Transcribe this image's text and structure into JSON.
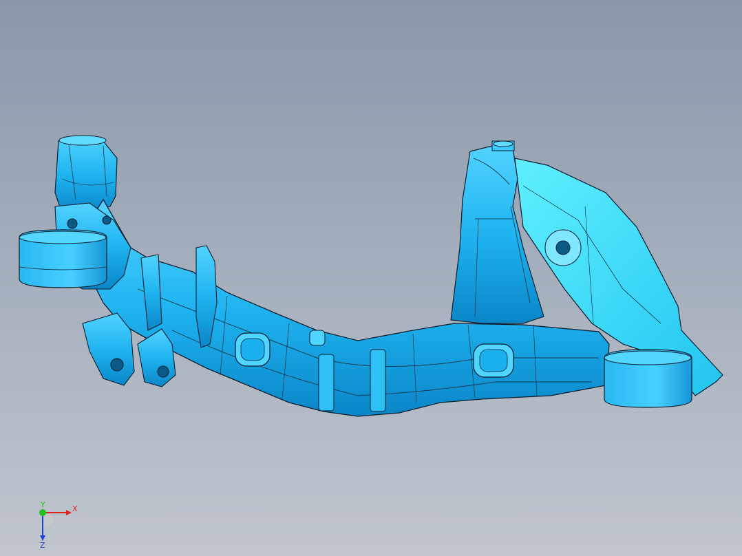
{
  "viewport": {
    "background_top": "#8a97aa",
    "background_bottom": "#c1c6ce"
  },
  "model": {
    "shape": "subframe-crossmember",
    "face_color": "#1fb4f0",
    "face_light": "#52d3ff",
    "face_dark": "#0a86c8",
    "edge_color": "#0b1c2e"
  },
  "triad": {
    "x_label": "X",
    "y_label": "Y",
    "z_label": "Z",
    "x_color": "#e02020",
    "y_color": "#20c020",
    "z_color": "#2040e0"
  }
}
